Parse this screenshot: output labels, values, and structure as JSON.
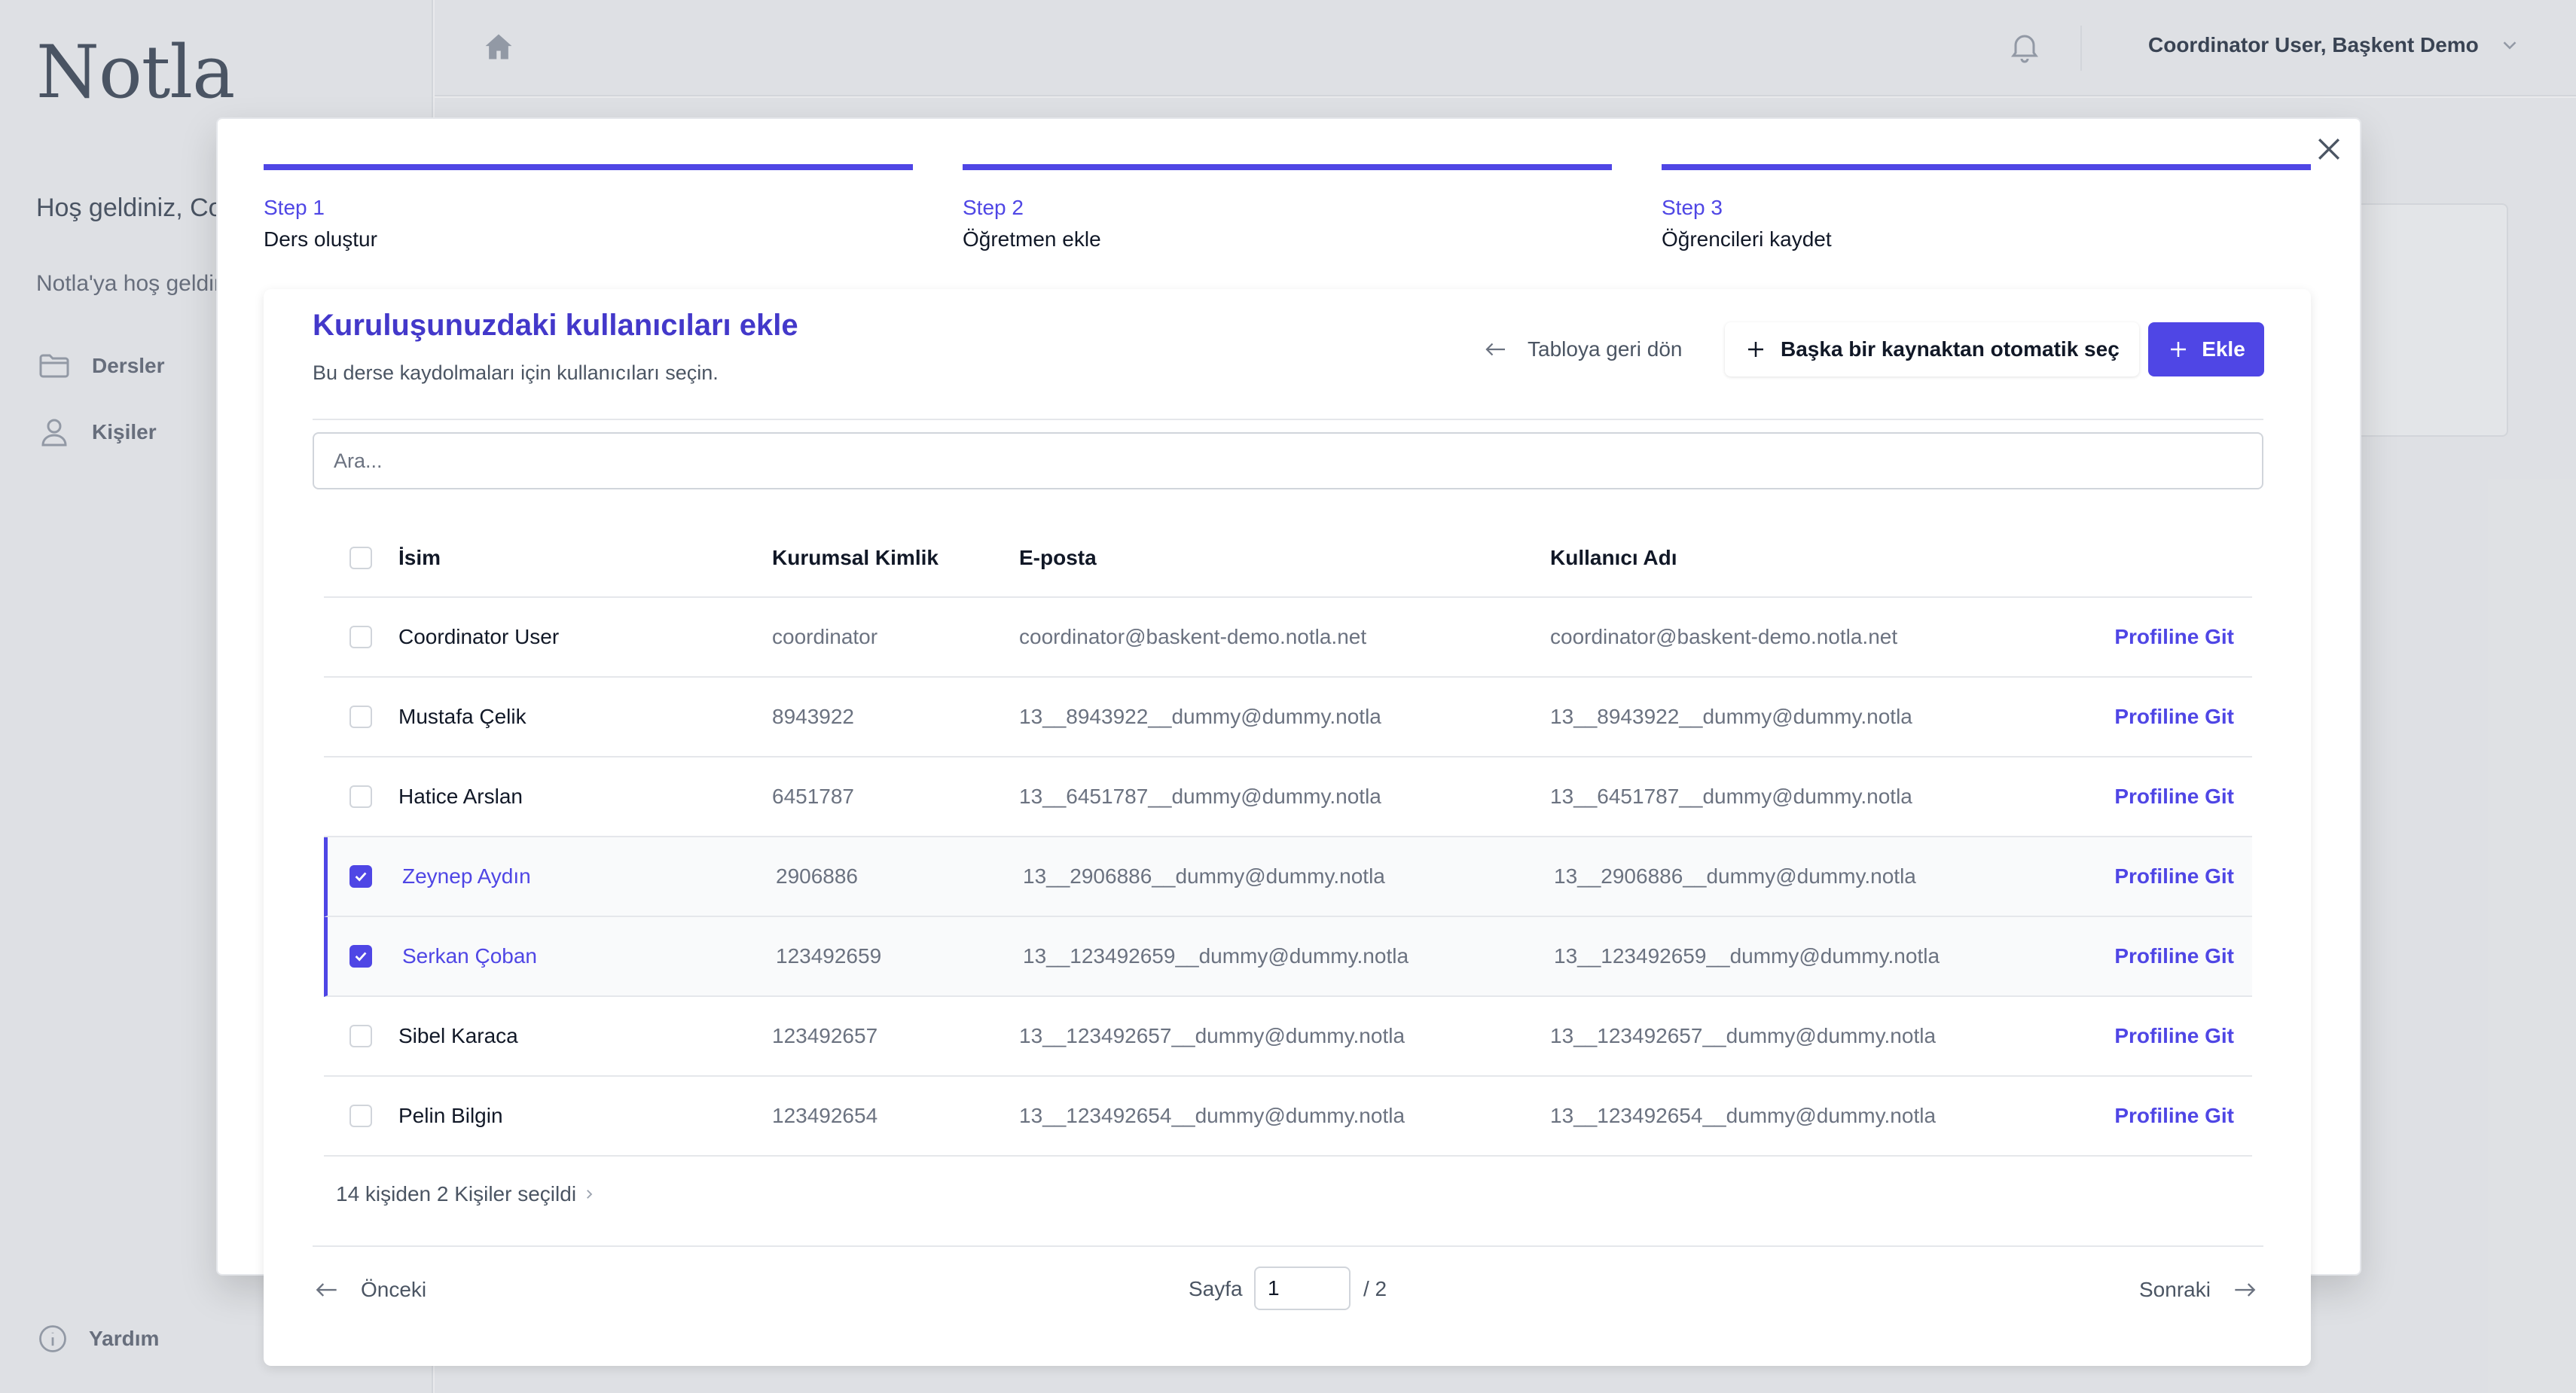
{
  "app": {
    "logo": "Notla",
    "welcome_line": "Hoş geldiniz, Coordinator User!",
    "welcome_sub": "Notla'ya hoş geldiniz",
    "nav": [
      {
        "label": "Dersler",
        "icon": "folder-icon"
      },
      {
        "label": "Kişiler",
        "icon": "user-icon"
      }
    ],
    "help_label": "Yardım",
    "user_menu": "Coordinator User, Başkent Demo"
  },
  "steps": [
    {
      "num": "Step 1",
      "title": "Ders oluştur"
    },
    {
      "num": "Step 2",
      "title": "Öğretmen ekle"
    },
    {
      "num": "Step 3",
      "title": "Öğrencileri kaydet"
    }
  ],
  "panel": {
    "title": "Kuruluşunuzdaki kullanıcıları ekle",
    "subtitle": "Bu derse kaydolmaları için kullanıcıları seçin.",
    "back_label": "Tabloya geri dön",
    "auto_select_label": "Başka bir kaynaktan otomatik seç",
    "add_label": "Ekle",
    "search_placeholder": "Ara..."
  },
  "table": {
    "columns": [
      "İsim",
      "Kurumsal Kimlik",
      "E-posta",
      "Kullanıcı Adı"
    ],
    "link_label": "Profiline Git",
    "rows": [
      {
        "name": "Coordinator User",
        "id": "coordinator",
        "email": "coordinator@baskent-demo.notla.net",
        "username": "coordinator@baskent-demo.notla.net",
        "selected": false
      },
      {
        "name": "Mustafa Çelik",
        "id": "8943922",
        "email": "13__8943922__dummy@dummy.notla",
        "username": "13__8943922__dummy@dummy.notla",
        "selected": false
      },
      {
        "name": "Hatice Arslan",
        "id": "6451787",
        "email": "13__6451787__dummy@dummy.notla",
        "username": "13__6451787__dummy@dummy.notla",
        "selected": false
      },
      {
        "name": "Zeynep Aydın",
        "id": "2906886",
        "email": "13__2906886__dummy@dummy.notla",
        "username": "13__2906886__dummy@dummy.notla",
        "selected": true
      },
      {
        "name": "Serkan Çoban",
        "id": "123492659",
        "email": "13__123492659__dummy@dummy.notla",
        "username": "13__123492659__dummy@dummy.notla",
        "selected": true
      },
      {
        "name": "Sibel Karaca",
        "id": "123492657",
        "email": "13__123492657__dummy@dummy.notla",
        "username": "13__123492657__dummy@dummy.notla",
        "selected": false
      },
      {
        "name": "Pelin Bilgin",
        "id": "123492654",
        "email": "13__123492654__dummy@dummy.notla",
        "username": "13__123492654__dummy@dummy.notla",
        "selected": false
      }
    ],
    "selection_summary": "14 kişiden 2 Kişiler seçildi"
  },
  "pagination": {
    "prev_label": "Önceki",
    "next_label": "Sonraki",
    "page_label": "Sayfa",
    "current_page": "1",
    "total_label": "/ 2"
  },
  "colors": {
    "accent": "#4f46e5",
    "sidebar_bg": "#f3f4f6"
  }
}
